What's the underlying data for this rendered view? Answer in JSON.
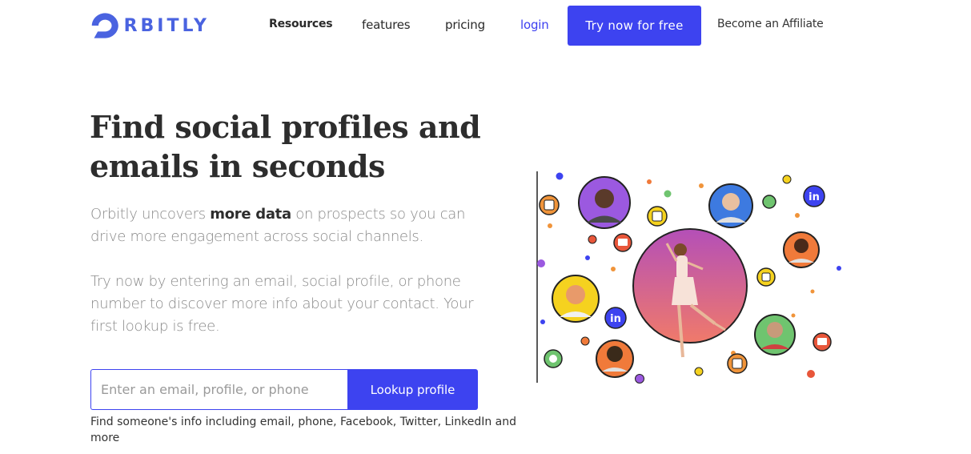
{
  "nav": {
    "logo_text": "RBITLY",
    "links": {
      "resources": "Resources",
      "features": "features",
      "pricing": "pricing",
      "login": "login"
    },
    "cta": "Try now for free",
    "affiliate": "Become an Affiliate"
  },
  "hero": {
    "title": "Find social profiles and emails in seconds",
    "para1_before": "Orbitly uncovers ",
    "para1_bold": "more data",
    "para1_after": " on prospects so you can drive more engagement across social channels.",
    "para2": "Try now by entering an email, social profile, or phone number to discover more info about your contact. Your first lookup is free."
  },
  "lookup": {
    "placeholder": "Enter an email, profile, or phone",
    "value": "",
    "button": "Lookup profile",
    "hint": "Find someone's info including email, phone, Facebook, Twitter, LinkedIn and more"
  },
  "colors": {
    "brand": "#3d43f0",
    "logo": "#4a63e0",
    "text_dark": "#2d2d2d",
    "text_muted": "#8a8a8a"
  },
  "illustration": {
    "icons": [
      "linkedin-icon",
      "mail-icon",
      "phone-icon",
      "chat-icon",
      "message-icon"
    ]
  }
}
